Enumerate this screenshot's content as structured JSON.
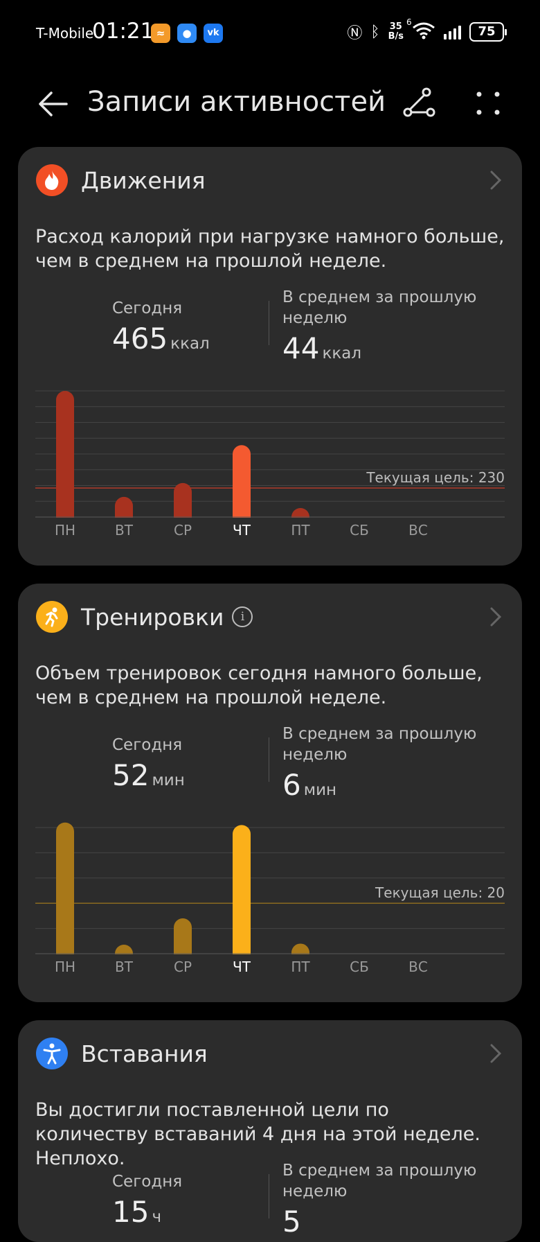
{
  "status_bar": {
    "carrier": "T-Mobile",
    "time": "01:21",
    "net_speed_value": "35",
    "net_speed_unit": "B/s",
    "signal_label": "6",
    "battery": "75",
    "app_icons": [
      "aliexpress-icon",
      "messages-icon",
      "vk-icon"
    ],
    "vk_label": "vk"
  },
  "header": {
    "title": "Записи активностей",
    "icons": [
      "back-arrow-icon",
      "route-icon",
      "more-dots-icon"
    ]
  },
  "colors": {
    "moves_accent": "#f24f25",
    "moves_bar": "#a8321f",
    "moves_bar_today": "#f45a30",
    "workouts_accent": "#fbb01a",
    "workouts_bar": "#a87819",
    "workouts_bar_today": "#fbb01a",
    "stand_accent": "#2f80f2",
    "card_bg": "#2c2c2c"
  },
  "cards": [
    {
      "title": "Движения",
      "icon": "flame-icon",
      "description": "Расход калорий при нагрузке намного больше, чем в среднем на прошлой неделе.",
      "today_label": "Сегодня",
      "today_value": "465",
      "today_unit": "ккал",
      "avg_label": "В среднем за прошлую неделю",
      "avg_value": "44",
      "avg_unit": "ккал"
    },
    {
      "title": "Тренировки",
      "icon": "running-person-icon",
      "has_info": true,
      "description": "Объем тренировок сегодня намного больше, чем в среднем на прошлой неделе.",
      "today_label": "Сегодня",
      "today_value": "52",
      "today_unit": "мин",
      "avg_label": "В среднем за прошлую неделю",
      "avg_value": "6",
      "avg_unit": "мин"
    },
    {
      "title": "Вставания",
      "icon": "standing-person-icon",
      "description": "Вы достигли поставленной цели по количеству вставаний 4 дня на этой неделе. Неплохо.",
      "today_label": "Сегодня",
      "today_value": "15",
      "today_unit": "ч",
      "avg_label": "В среднем за прошлую неделю",
      "avg_value": "5",
      "avg_unit": ""
    }
  ],
  "chart_data": [
    {
      "type": "bar",
      "categories": [
        "ПН",
        "ВТ",
        "СР",
        "ЧТ",
        "ПТ",
        "СБ",
        "ВС"
      ],
      "highlight_category": "ЧТ",
      "values": [
        1000,
        160,
        270,
        570,
        60,
        0,
        0
      ],
      "goal": 230,
      "goal_label": "Текущая цель: 230",
      "ylim": [
        0,
        1000
      ],
      "gridlines": 8,
      "grid": true
    },
    {
      "type": "bar",
      "categories": [
        "ПН",
        "ВТ",
        "СР",
        "ЧТ",
        "ПТ",
        "СБ",
        "ВС"
      ],
      "highlight_category": "ЧТ",
      "values": [
        52,
        3,
        14,
        51,
        4,
        0,
        0
      ],
      "goal": 20,
      "goal_label": "Текущая цель: 20",
      "ylim": [
        0,
        50
      ],
      "gridlines": 5,
      "grid": true
    }
  ]
}
